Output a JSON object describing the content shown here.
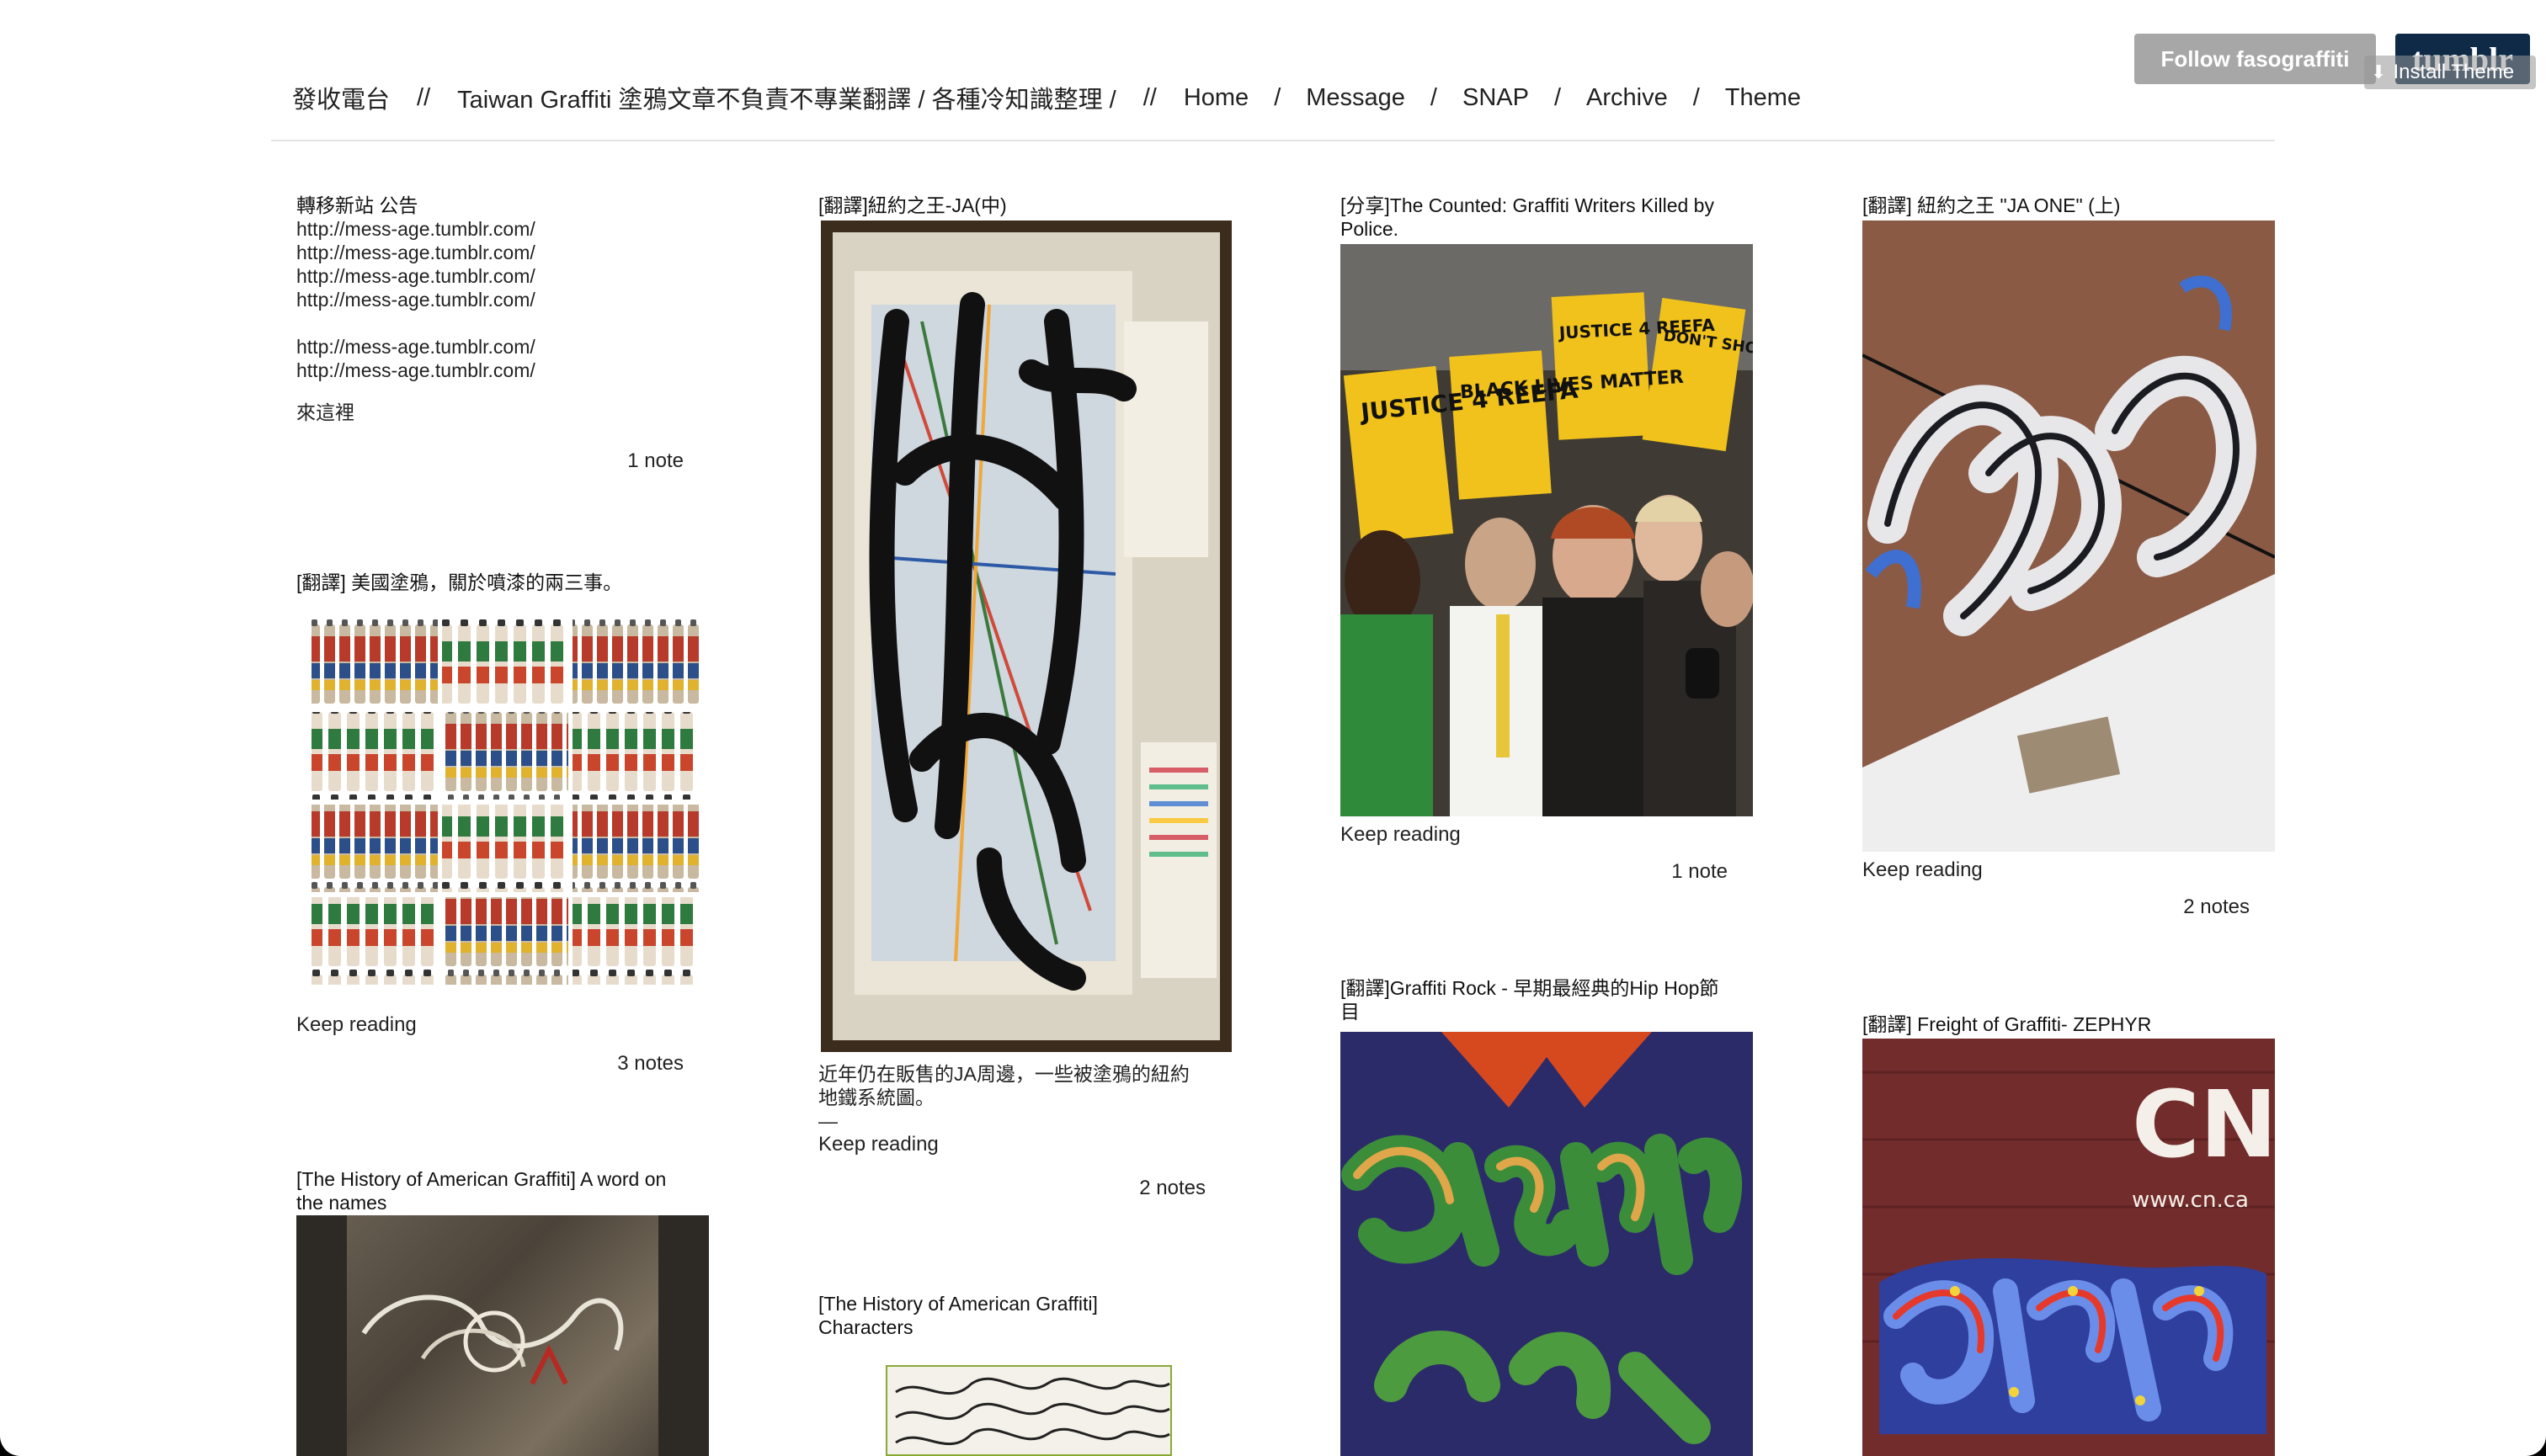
{
  "header": {
    "site_title": "發收電台",
    "sep_double": "//",
    "tagline": "Taiwan Graffiti 塗鴉文章不負責不專業翻譯 / 各種冷知識整理 /",
    "sep_single": "/",
    "nav": [
      "Home",
      "Message",
      "SNAP",
      "Archive",
      "Theme"
    ]
  },
  "controls": {
    "follow_label": "Follow fasograffiti",
    "tumblr_label": "tumblr",
    "install_label": "Install Theme"
  },
  "posts": {
    "p1": {
      "title": "轉移新站 公告",
      "lines": [
        "http://mess-age.tumblr.com/",
        "http://mess-age.tumblr.com/",
        "http://mess-age.tumblr.com/",
        "http://mess-age.tumblr.com/",
        "http://mess-age.tumblr.com/",
        "http://mess-age.tumblr.com/"
      ],
      "cta": "來這裡",
      "notes": "1 note"
    },
    "p2": {
      "title": "[翻譯] 美國塗鴉，關於噴漆的兩三事。",
      "keep": "Keep reading",
      "notes": "3 notes"
    },
    "p3": {
      "title": "[The History of American Graffiti] A word on the names"
    },
    "p4": {
      "title": "[翻譯]紐約之王-JA(中)",
      "caption": "近年仍在販售的JA周邊，一些被塗鴉的紐約地鐵系統圖。",
      "dash": "—",
      "keep": "Keep reading",
      "notes": "2 notes"
    },
    "p5": {
      "title": "[The History of American Graffiti] Characters"
    },
    "p6": {
      "title": "[分享]The Counted: Graffiti Writers Killed by Police.",
      "keep": "Keep reading",
      "notes": "1 note",
      "signs": [
        "JUSTICE 4 REEFA",
        "BLACK LIVES MATTER",
        "JUSTICE 4 REEFA",
        "DON'T SHOOT"
      ]
    },
    "p7": {
      "title": "[翻譯]Graffiti Rock - 早期最經典的Hip Hop節目"
    },
    "p8": {
      "title": "[翻譯] 紐約之王 \"JA ONE\" (上)",
      "keep": "Keep reading",
      "notes": "2 notes"
    },
    "p9": {
      "title": "[翻譯] Freight of Graffiti- ZEPHYR",
      "logo": "CN",
      "url": "www.cn.ca"
    }
  }
}
